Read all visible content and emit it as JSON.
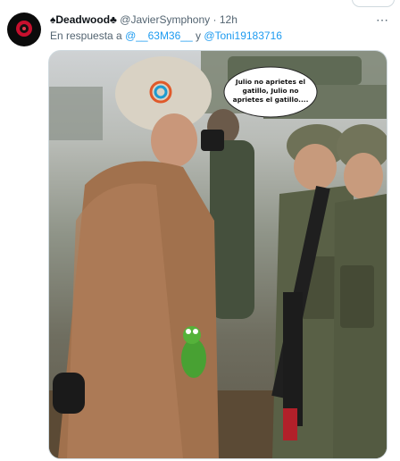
{
  "tweet": {
    "name_prefix": "♠",
    "name": "Deadwood",
    "name_suffix": "♣",
    "handle": "@JavierSymphony",
    "separator": "·",
    "time": "12h",
    "reply_prefix": "En respuesta a",
    "mention_1": "@__63M36__",
    "conjunction": "y",
    "mention_2": "@Toni19183716",
    "more_icon": "⋯"
  },
  "media": {
    "speech_bubble": "Julio no aprietes el gatillo, Julio no aprietes el gatillo...."
  }
}
